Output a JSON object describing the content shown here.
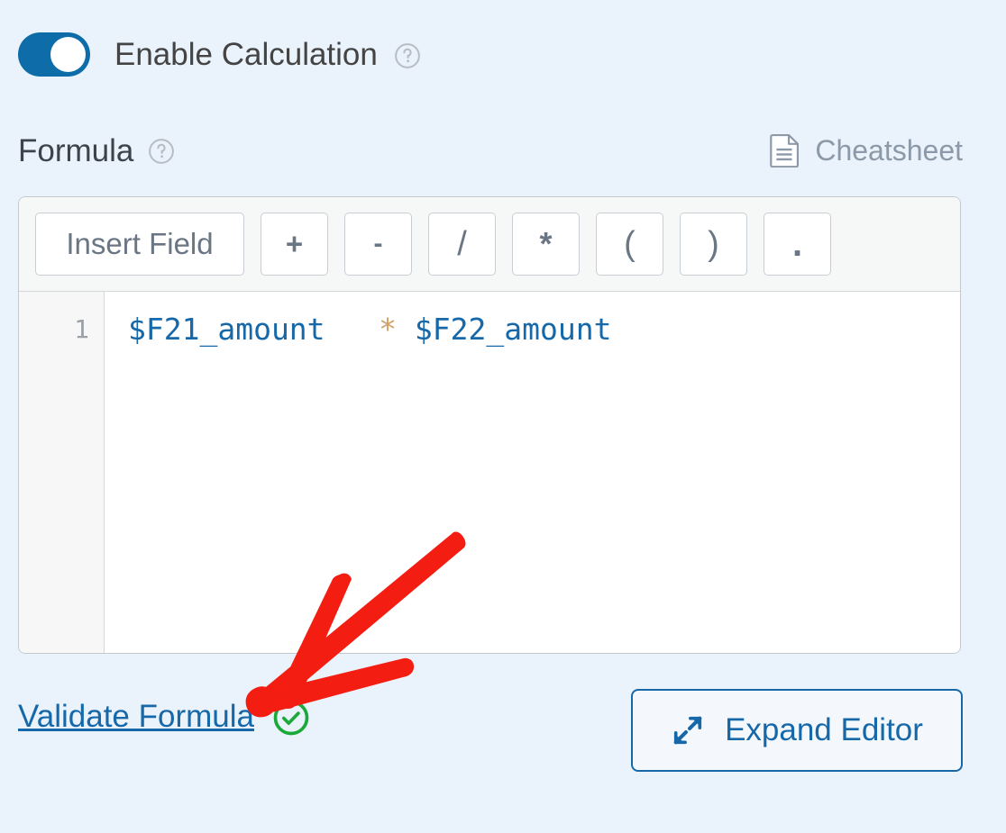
{
  "colors": {
    "background": "#eaf2fb",
    "toggle_on": "#0e6ca8",
    "accent_link": "#1668a8",
    "validate_check_green": "#1ba939",
    "annotation_red": "#f41d12",
    "token_variable": "#1668a8",
    "token_operator": "#d0a068",
    "muted_text": "#8c99a8"
  },
  "enable_calculation": {
    "label": "Enable Calculation",
    "toggle_state": "on",
    "help_icon": "question-circle-icon"
  },
  "formula_section": {
    "title": "Formula",
    "help_icon": "question-circle-icon",
    "cheatsheet": {
      "label": "Cheatsheet",
      "icon": "document-icon"
    }
  },
  "toolbar": {
    "insert_field_label": "Insert Field",
    "operators": [
      {
        "label": "+",
        "name": "plus"
      },
      {
        "label": "-",
        "name": "minus"
      },
      {
        "label": "/",
        "name": "slash"
      },
      {
        "label": "*",
        "name": "star"
      },
      {
        "label": "(",
        "name": "paren-open"
      },
      {
        "label": ")",
        "name": "paren-close"
      },
      {
        "label": ".",
        "name": "dot"
      }
    ]
  },
  "editor": {
    "line_number": "1",
    "tokens": {
      "operand_left": "$F21_amount",
      "operator": "*",
      "operand_right": "$F22_amount"
    },
    "full_text": "$F21_amount * $F22_amount"
  },
  "footer": {
    "validate_label": "Validate Formula",
    "validate_status_icon": "check-circle-icon",
    "expand_label": "Expand Editor",
    "expand_icon": "expand-arrows-icon"
  },
  "annotation": {
    "type": "arrow",
    "points_to": "Validate Formula",
    "color": "#f41d12"
  }
}
